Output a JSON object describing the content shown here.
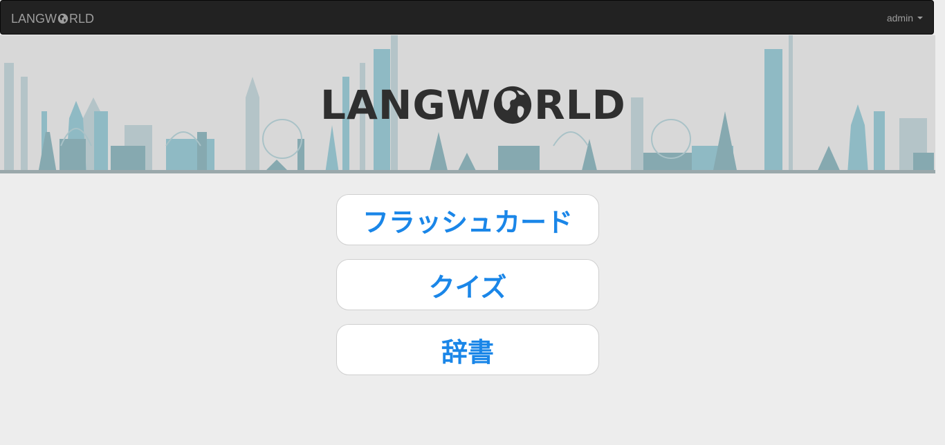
{
  "nav": {
    "brand_prefix": "LANGW",
    "brand_suffix": "RLD",
    "user": "admin"
  },
  "banner": {
    "logo_prefix": "LANGW",
    "logo_suffix": "RLD"
  },
  "menu": {
    "items": [
      {
        "label": "フラッシュカード"
      },
      {
        "label": "クイズ"
      },
      {
        "label": "辞書"
      }
    ]
  },
  "colors": {
    "navbar": "#222222",
    "banner": "#d8d8d8",
    "accent": "#1a86e8",
    "background": "#ededed"
  }
}
